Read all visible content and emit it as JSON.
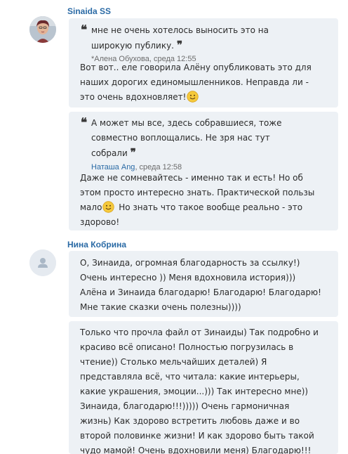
{
  "post1": {
    "author": "Sinaida SS",
    "message1": {
      "quote_text": "мне не очень хотелось выносить это на широкую публику.",
      "quote_attribution": "*Алена Обухова, среда 12:55",
      "body_before_emoji": "Вот вот.. еле говорила Алёну опубликовать это для наших дорогих единомышленников. Неправда ли - это очень вдохновляет!",
      "emoji": "smile-emoji"
    },
    "message2": {
      "quote_text": "А может мы все, здесь собравшиеся, тоже совместно воплощались. Не зря нас тут собрали",
      "quote_author": "Наташа Ang",
      "quote_time": ", среда 12:58",
      "body_before_emoji": "Даже не сомневайтесь - именно так и есть! Но об этом просто интересно знать. Практической пользы мало",
      "body_after_emoji": " Но знать что такое вообще реально - это здорово!",
      "emoji": "smile-emoji"
    }
  },
  "post2": {
    "author": "Нина Кобрина",
    "message1": {
      "body": "О, Зинаида, огромная благодарность за ссылку!) Очень интересно )) Меня вдохновила история))) Алёна и Зинаида благодарю! Благодарю! Благодарю! Мне такие сказки очень полезны))))"
    },
    "message2": {
      "body": "Только что прочла файл от Зинаиды) Так подробно и красиво всё описано! Полностью погрузилась в чтение)) Столько мельчайших деталей) Я представляла всё, что читала: какие интерьеры, какие украшения, эмоции...))) Так интересно мне)) Зинаида, благодарю!!!))))) Очень гармоничная жизнь)  Как здорово встретить любовь даже и во второй половинке жизни! И как здорово быть такой чудо мамой! Очень вдохновили меня) Благодарю!!!"
    }
  },
  "colors": {
    "author_link": "#2a6aa5",
    "bubble_bg": "#edf1f5",
    "text": "#2b2b2b",
    "meta": "#6b6b6b"
  }
}
